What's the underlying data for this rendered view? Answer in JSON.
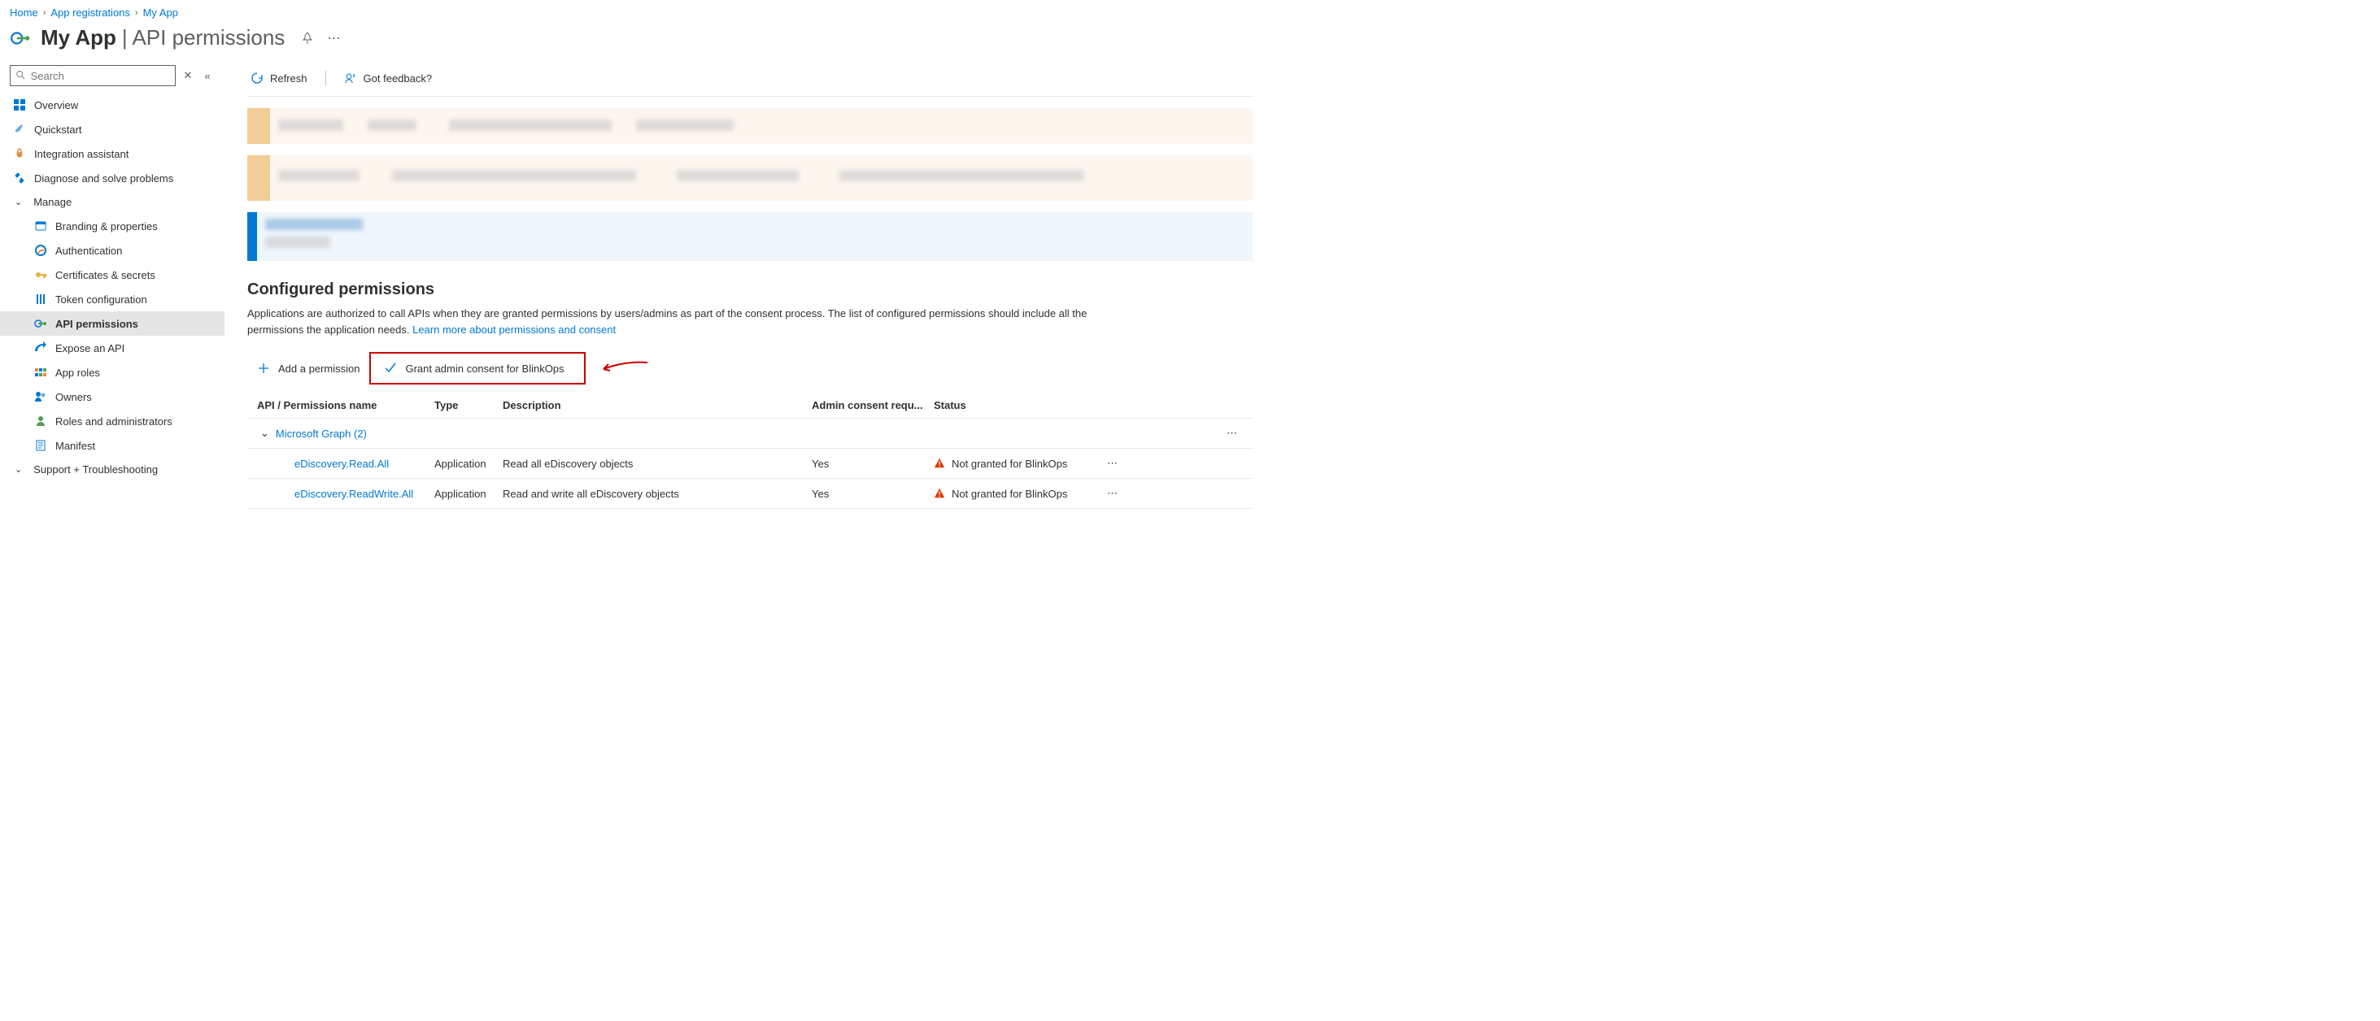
{
  "breadcrumb": [
    "Home",
    "App registrations",
    "My App"
  ],
  "header": {
    "app_name": "My App",
    "page": "API permissions"
  },
  "search_placeholder": "Search",
  "sidebar": {
    "top": [
      {
        "label": "Overview",
        "icon": "overview"
      },
      {
        "label": "Quickstart",
        "icon": "quickstart"
      },
      {
        "label": "Integration assistant",
        "icon": "rocket"
      },
      {
        "label": "Diagnose and solve problems",
        "icon": "diagnose"
      }
    ],
    "section_manage": "Manage",
    "manage": [
      {
        "label": "Branding & properties",
        "icon": "branding"
      },
      {
        "label": "Authentication",
        "icon": "auth"
      },
      {
        "label": "Certificates & secrets",
        "icon": "key"
      },
      {
        "label": "Token configuration",
        "icon": "token"
      },
      {
        "label": "API permissions",
        "icon": "api-perm",
        "active": true
      },
      {
        "label": "Expose an API",
        "icon": "expose"
      },
      {
        "label": "App roles",
        "icon": "roles"
      },
      {
        "label": "Owners",
        "icon": "owners"
      },
      {
        "label": "Roles and administrators",
        "icon": "admins"
      },
      {
        "label": "Manifest",
        "icon": "manifest"
      }
    ],
    "section_support": "Support + Troubleshooting"
  },
  "toolbar": {
    "refresh": "Refresh",
    "feedback": "Got feedback?"
  },
  "configured": {
    "title": "Configured permissions",
    "desc": "Applications are authorized to call APIs when they are granted permissions by users/admins as part of the consent process. The list of configured permissions should include all the permissions the application needs.",
    "link": "Learn more about permissions and consent"
  },
  "actions": {
    "add": "Add a permission",
    "grant": "Grant admin consent for BlinkOps"
  },
  "table": {
    "headers": {
      "name": "API / Permissions name",
      "type": "Type",
      "desc": "Description",
      "admin": "Admin consent requ...",
      "status": "Status"
    },
    "group": "Microsoft Graph (2)",
    "rows": [
      {
        "name": "eDiscovery.Read.All",
        "type": "Application",
        "desc": "Read all eDiscovery objects",
        "admin": "Yes",
        "status": "Not granted for BlinkOps"
      },
      {
        "name": "eDiscovery.ReadWrite.All",
        "type": "Application",
        "desc": "Read and write all eDiscovery objects",
        "admin": "Yes",
        "status": "Not granted for BlinkOps"
      }
    ]
  }
}
